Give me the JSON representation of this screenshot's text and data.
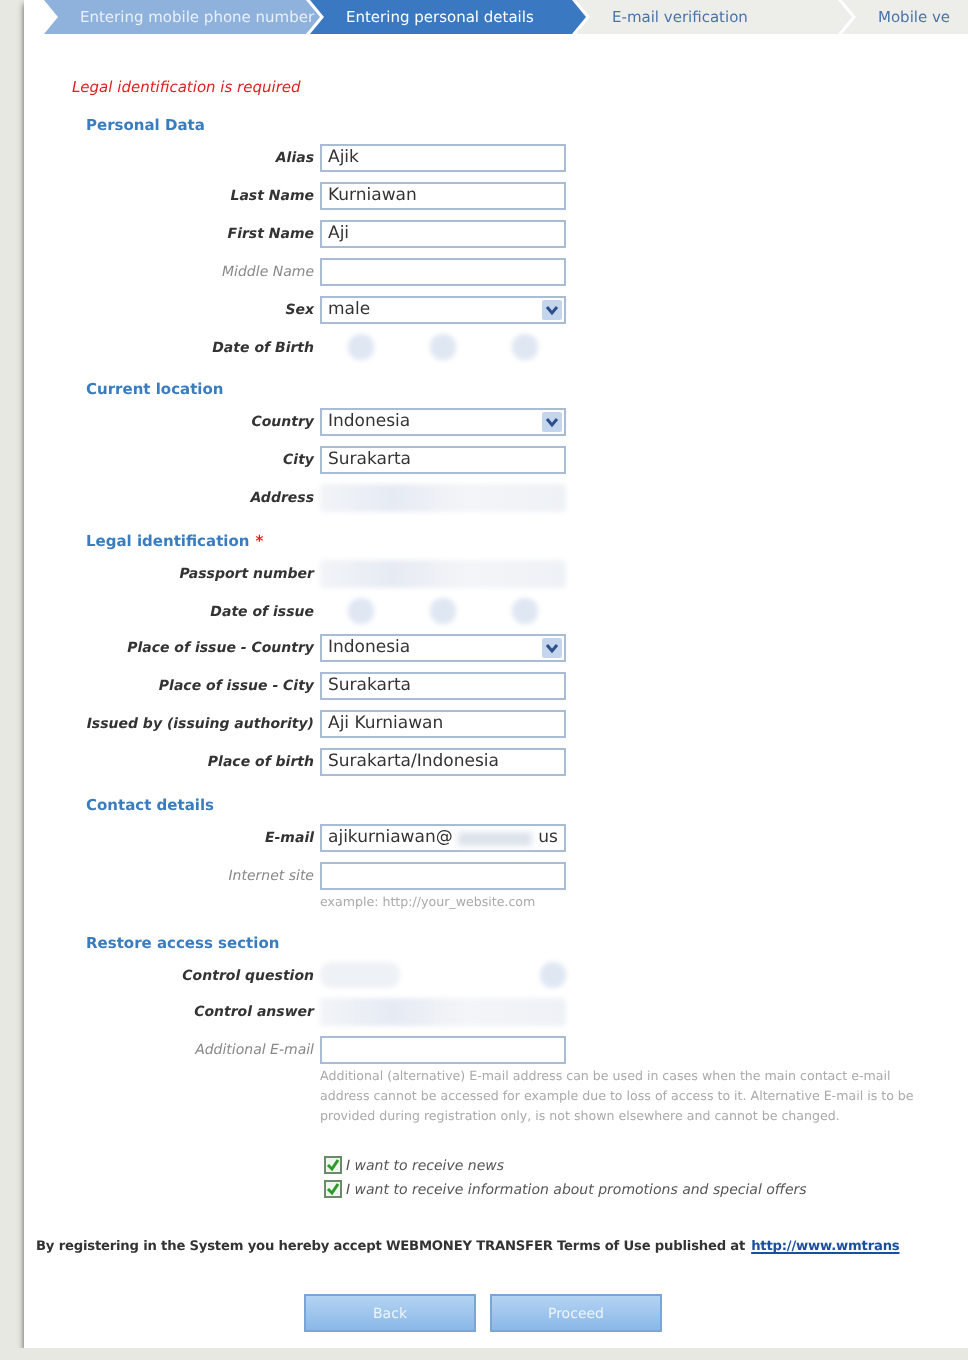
{
  "steps": [
    {
      "label": "Entering mobile phone number",
      "selected": false,
      "completed": true
    },
    {
      "label": "Entering personal details",
      "selected": true,
      "completed": false
    },
    {
      "label": "E-mail verification",
      "selected": false,
      "completed": false
    },
    {
      "label": "Mobile ve",
      "selected": false,
      "completed": false
    }
  ],
  "error": "Legal identification is required",
  "sections": [
    {
      "title": "Personal Data",
      "rows": [
        {
          "label": "Alias",
          "required": true,
          "kind": "text",
          "value": "Ajik"
        },
        {
          "label": "Last Name",
          "required": true,
          "kind": "text",
          "value": "Kurniawan"
        },
        {
          "label": "First Name",
          "required": true,
          "kind": "text",
          "value": "Aji"
        },
        {
          "label": "Middle Name",
          "required": false,
          "kind": "text"
        },
        {
          "label": "Sex",
          "required": true,
          "kind": "select",
          "value": "male"
        },
        {
          "label": "Date of Birth",
          "required": true,
          "kind": "redacted-date"
        }
      ]
    },
    {
      "title": "Current location",
      "rows": [
        {
          "label": "Country",
          "required": true,
          "kind": "select",
          "value": "Indonesia"
        },
        {
          "label": "City",
          "required": true,
          "kind": "text",
          "value": "Surakarta"
        },
        {
          "label": "Address",
          "required": true,
          "kind": "redacted-text"
        }
      ]
    },
    {
      "title": "Legal identification",
      "mark": "*",
      "rows": [
        {
          "label": "Passport number",
          "required": true,
          "kind": "redacted-text"
        },
        {
          "label": "Date of issue",
          "required": true,
          "kind": "redacted-date"
        },
        {
          "label": "Place of issue - Country",
          "required": true,
          "kind": "select",
          "value": "Indonesia"
        },
        {
          "label": "Place of issue - City",
          "required": true,
          "kind": "text",
          "value": "Surakarta"
        },
        {
          "label": "Issued by (issuing authority)",
          "required": true,
          "kind": "text",
          "value": "Aji Kurniawan"
        },
        {
          "label": "Place of birth",
          "required": true,
          "kind": "text",
          "value": "Surakarta/Indonesia"
        }
      ]
    },
    {
      "title": "Contact details",
      "rows": [
        {
          "label": "E-mail",
          "required": true,
          "kind": "partly-redacted",
          "value_parts": [
            "ajikurniawan@",
            "us"
          ]
        },
        {
          "label": "Internet site",
          "required": false,
          "kind": "text",
          "hint": "example: http://your_website.com"
        }
      ]
    },
    {
      "title": "Restore access section",
      "rows": [
        {
          "label": "Control question",
          "required": true,
          "kind": "redacted-select"
        },
        {
          "label": "Control answer",
          "required": true,
          "kind": "redacted-text"
        },
        {
          "label": "Additional E-mail",
          "required": false,
          "kind": "text",
          "hint": "Additional (alternative) E-mail address can be used in cases when the main contact e-mail address cannot be accessed for example due to loss of access to it. Alternative E-mail is to be provided during registration only, is not shown elsewhere and cannot be changed."
        }
      ]
    }
  ],
  "checkboxes": [
    {
      "label": "I want to receive news",
      "checked": true
    },
    {
      "label": "I want to receive information about promotions and special offers",
      "checked": true
    }
  ],
  "terms": {
    "text": "By registering in the System you hereby accept WEBMONEY TRANSFER Terms of Use published at",
    "link": "http://www.wmtrans"
  },
  "buttons": [
    {
      "label": "Back"
    },
    {
      "label": "Proceed"
    }
  ]
}
